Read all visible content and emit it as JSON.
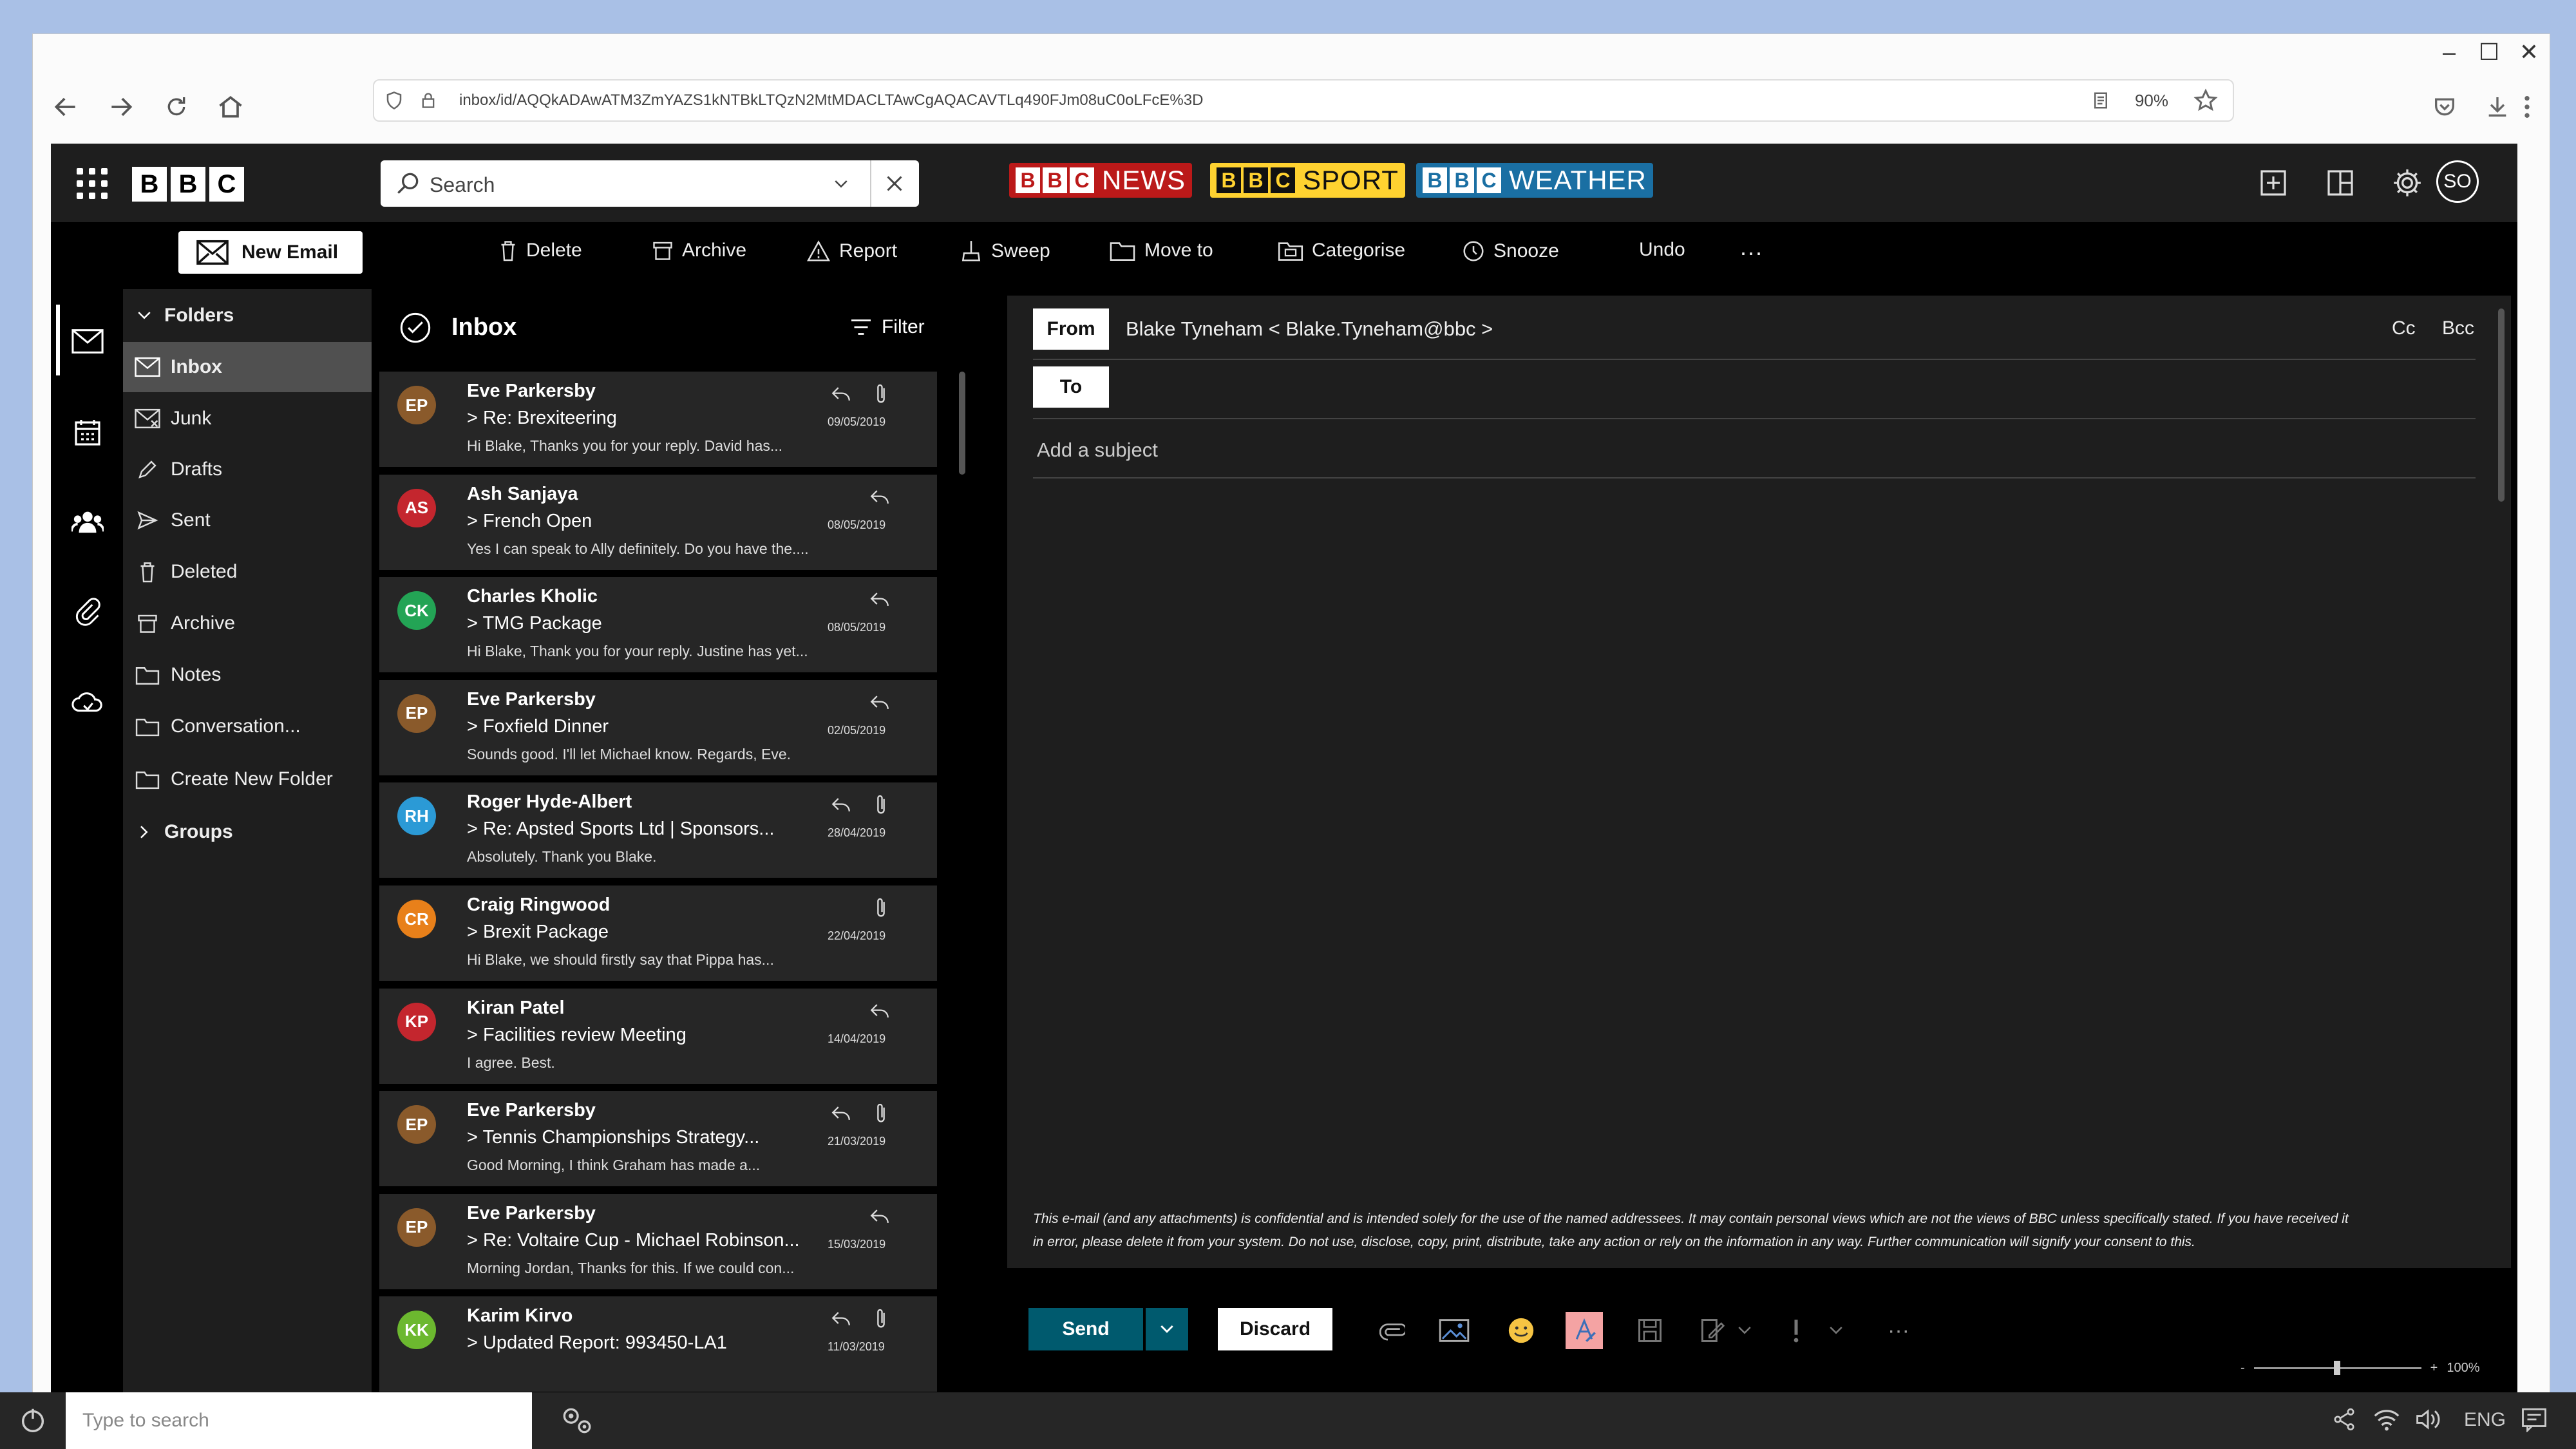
{
  "browser": {
    "url": "inbox/id/AQQkADAwATM3ZmYAZS1kNTBkLTQzN2MtMDACLTAwCgAQACAVTLq490FJm08uC0oLFcE%3D",
    "zoom": "90%"
  },
  "app": {
    "logo": [
      "B",
      "B",
      "C"
    ],
    "search_placeholder": "Search",
    "brands": [
      {
        "blocks": [
          "B",
          "B",
          "C"
        ],
        "word": "NEWS",
        "bg": "#bb1919",
        "fg": "#ffffff"
      },
      {
        "blocks": [
          "B",
          "B",
          "C"
        ],
        "word": "SPORT",
        "bg": "#ffd230",
        "fg": "#111111"
      },
      {
        "blocks": [
          "B",
          "B",
          "C"
        ],
        "word": "WEATHER",
        "bg": "#1a6fa3",
        "fg": "#ffffff"
      }
    ],
    "user_initials": "SO"
  },
  "toolbar": {
    "new_email": "New Email",
    "commands": [
      {
        "label": "Delete",
        "icon": "trash-icon"
      },
      {
        "label": "Archive",
        "icon": "archive-icon"
      },
      {
        "label": "Report",
        "icon": "warning-icon"
      },
      {
        "label": "Sweep",
        "icon": "sweep-icon"
      },
      {
        "label": "Move to",
        "icon": "folder-icon"
      },
      {
        "label": "Categorise",
        "icon": "tag-icon"
      },
      {
        "label": "Snooze",
        "icon": "clock-icon"
      },
      {
        "label": "Undo",
        "icon": ""
      }
    ],
    "more": "···"
  },
  "folders": {
    "header": "Folders",
    "items": [
      {
        "label": "Inbox",
        "icon": "inbox-icon",
        "selected": true
      },
      {
        "label": "Junk",
        "icon": "junk-icon"
      },
      {
        "label": "Drafts",
        "icon": "drafts-icon"
      },
      {
        "label": "Sent",
        "icon": "sent-icon"
      },
      {
        "label": "Deleted",
        "icon": "trash-icon"
      },
      {
        "label": "Archive",
        "icon": "archive-icon"
      },
      {
        "label": "Notes",
        "icon": "folder-icon"
      },
      {
        "label": "Conversation...",
        "icon": "folder-icon"
      },
      {
        "label": "Create New Folder",
        "icon": "folder-icon"
      }
    ],
    "groups": "Groups"
  },
  "inbox": {
    "title": "Inbox",
    "filter": "Filter",
    "messages": [
      {
        "initials": "EP",
        "color": "#8a5a2b",
        "sender": "Eve Parkersby",
        "subject": "> Re: Brexiteering",
        "preview": "Hi Blake, Thanks you for your reply. David has...",
        "date": "09/05/2019",
        "reply": true,
        "attach": true
      },
      {
        "initials": "AS",
        "color": "#c4262e",
        "sender": "Ash Sanjaya",
        "subject": "> French Open",
        "preview": "Yes I can speak to Ally definitely. Do you have the....",
        "date": "08/05/2019",
        "reply": true,
        "attach": false
      },
      {
        "initials": "CK",
        "color": "#23a455",
        "sender": "Charles Kholic",
        "subject": "> TMG Package",
        "preview": "Hi Blake, Thank you for your reply. Justine has yet...",
        "date": "08/05/2019",
        "reply": true,
        "attach": false
      },
      {
        "initials": "EP",
        "color": "#8a5a2b",
        "sender": "Eve Parkersby",
        "subject": "> Foxfield Dinner",
        "preview": "Sounds good. I'll let Michael know. Regards, Eve.",
        "date": "02/05/2019",
        "reply": true,
        "attach": false
      },
      {
        "initials": "RH",
        "color": "#2b9ad6",
        "sender": "Roger Hyde-Albert",
        "subject": "> Re: Apsted Sports Ltd | Sponsors...",
        "preview": "Absolutely. Thank you Blake.",
        "date": "28/04/2019",
        "reply": true,
        "attach": true
      },
      {
        "initials": "CR",
        "color": "#e8801a",
        "sender": "Craig Ringwood",
        "subject": "> Brexit Package",
        "preview": "Hi Blake, we should firstly say that Pippa has...",
        "date": "22/04/2019",
        "reply": false,
        "attach": true
      },
      {
        "initials": "KP",
        "color": "#c4262e",
        "sender": "Kiran Patel",
        "subject": "> Facilities review Meeting",
        "preview": "I agree. Best.",
        "date": "14/04/2019",
        "reply": true,
        "attach": false
      },
      {
        "initials": "EP",
        "color": "#8a5a2b",
        "sender": "Eve Parkersby",
        "subject": "> Tennis Championships Strategy...",
        "preview": "Good Morning, I think Graham has made a...",
        "date": "21/03/2019",
        "reply": true,
        "attach": true
      },
      {
        "initials": "EP",
        "color": "#8a5a2b",
        "sender": "Eve Parkersby",
        "subject": "> Re: Voltaire Cup - Michael Robinson...",
        "preview": "Morning Jordan, Thanks for this. If we could con...",
        "date": "15/03/2019",
        "reply": true,
        "attach": false
      },
      {
        "initials": "KK",
        "color": "#6cb82f",
        "sender": "Karim Kirvo",
        "subject": "> Updated Report: 993450-LA1",
        "preview": "",
        "date": "11/03/2019",
        "reply": true,
        "attach": true
      }
    ]
  },
  "compose": {
    "from_label": "From",
    "from_value": "Blake Tyneham < Blake.Tyneham@bbc >",
    "cc": "Cc",
    "bcc": "Bcc",
    "to_label": "To",
    "subject_placeholder": "Add a subject",
    "disclaimer_1": "This e-mail (and any attachments) is confidential and is intended solely for the use of the named addressees.  It may contain personal views which are not the views of BBC unless specifically stated.  If you have received it",
    "disclaimer_2": "in error, please delete it from your system.  Do not use, disclose, copy, print, distribute, take any action or rely on the information in any way.  Further communication will signify your consent to this.",
    "send": "Send",
    "discard": "Discard",
    "more": "···",
    "zoom_minus": "-",
    "zoom_plus": "+",
    "zoom_value": "100%"
  },
  "taskbar": {
    "search_placeholder": "Type to search",
    "lang": "ENG"
  }
}
